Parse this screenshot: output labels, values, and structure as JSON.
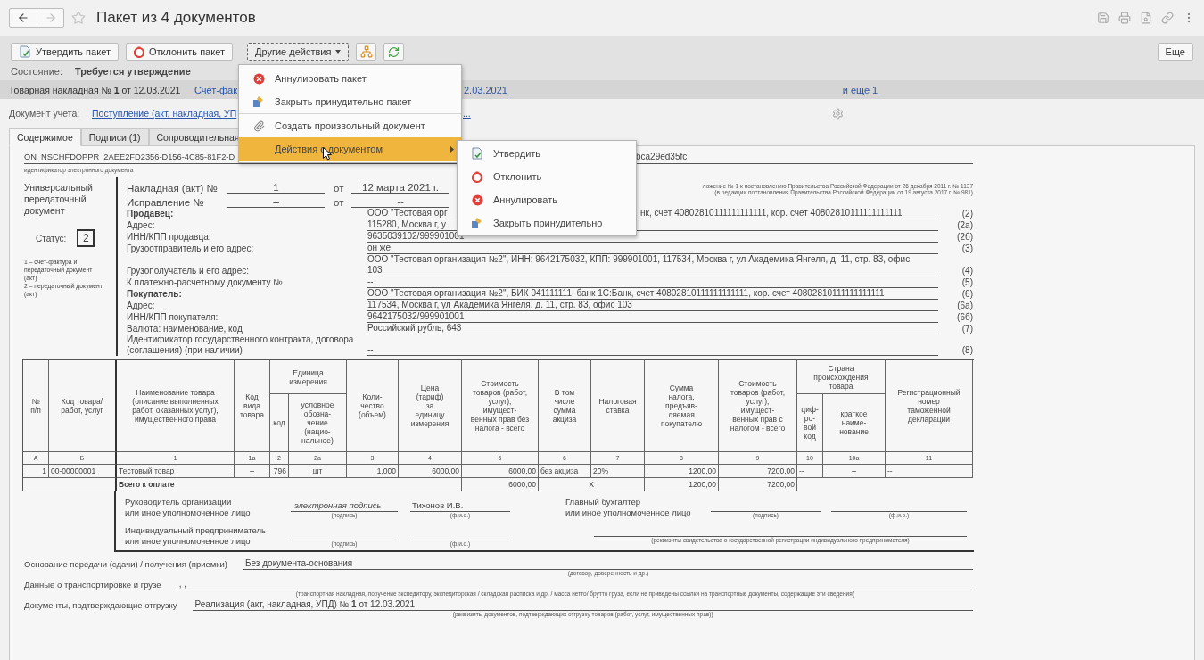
{
  "window": {
    "title": "Пакет из 4 документов",
    "favorite": false
  },
  "toolbar": {
    "buttons": [
      {
        "label": "Утвердить пакет",
        "kind": "approve",
        "open": false
      },
      {
        "label": "Отклонить пакет",
        "kind": "reject",
        "open": false
      },
      {
        "label": "Другие действия",
        "kind": "dropdown",
        "open": true
      }
    ],
    "icon_buttons": [
      {
        "kind": "structure"
      },
      {
        "kind": "refresh"
      }
    ],
    "more": "Еще"
  },
  "state": {
    "label": "Состояние:",
    "value": "Требуется утверждение"
  },
  "documents": {
    "current": "Товарная накладная № **1** от 12.03.2021",
    "links": [
      "Счет-фак",
      "2.03.2021",
      "и еще 1"
    ]
  },
  "account": {
    "label": "Документ учета:",
    "link": "Поступление (акт, накладная, УП",
    "link_tail": "..."
  },
  "tabs": [
    {
      "label": "Содержимое",
      "selected": true
    },
    {
      "label": "Подписи (1)",
      "selected": false
    },
    {
      "label": "Сопроводительная",
      "selected": false
    }
  ],
  "menu": {
    "items": [
      {
        "label": "Аннулировать пакет",
        "separator_before": false,
        "submenu": false,
        "selected": false
      },
      {
        "label": "Закрыть принудительно пакет",
        "separator_before": false,
        "submenu": false,
        "selected": false
      },
      {
        "label": "Создать произвольный документ",
        "separator_before": true,
        "submenu": false,
        "selected": false
      },
      {
        "label": "Действия с документом",
        "separator_before": false,
        "submenu": true,
        "selected": true
      }
    ]
  },
  "submenu": {
    "items": [
      {
        "label": "Утвердить"
      },
      {
        "label": "Отклонить"
      },
      {
        "label": "Аннулировать"
      },
      {
        "label": "Закрыть принудительно"
      }
    ]
  },
  "document": {
    "id_left": "ON_NSCHFDOPPR_2AEE2FD2356-D156-4C85-81F2-D",
    "id_right": "bca29ed35fc",
    "id_caption": "идентификатор электронного документа",
    "notes": [
      "ложение № 1 к постановлению Правительства Российской Федерации от 26 декабря 2011 г. № 1137",
      "(в редакции постановления Правительства Российской Федерации от 19 августа 2017 г. № 981)"
    ],
    "doc_type": "Универсальный передаточный документ",
    "status_label": "Статус:",
    "status_value": "2",
    "status_legend": [
      "1 – счет-фактура и передаточный документ (акт)",
      "2 – передаточный документ (акт)"
    ],
    "number_label": "Накладная (акт) №",
    "number": "1",
    "date_label": "от",
    "date": "12 марта 2021 г.",
    "correction_label": "Исправление №",
    "correction": "--",
    "correction_date_label": "от",
    "correction_date": "--",
    "fields": [
      {
        "label": "Продавец:",
        "bold": true,
        "value": "ООО \"Тестовая орг",
        "value_tail": "нк, счет 40802810111111111111, кор. счет 40802810111111111111",
        "code": "(2)"
      },
      {
        "label": "Адрес:",
        "bold": false,
        "value": "115280, Москва г, у",
        "code": "(2а)"
      },
      {
        "label": "ИНН/КПП продавца:",
        "bold": false,
        "value": "9635039102/999901001",
        "code": "(2б)"
      },
      {
        "label": "Грузоотправитель и его адрес:",
        "bold": false,
        "value": "он же",
        "code": "(3)"
      },
      {
        "label": "Грузополучатель и его адрес:",
        "bold": false,
        "value": "ООО \"Тестовая организация №2\", ИНН: 9642175032, КПП: 999901001, 117534, Москва г, ул Академика Янгеля, д. 11, стр. 83, офис\n103",
        "code": "(4)"
      },
      {
        "label": "К платежно-расчетному документу №",
        "bold": false,
        "value": "--",
        "code": "(5)"
      },
      {
        "label": "Покупатель:",
        "bold": true,
        "value": "ООО \"Тестовая организация №2\", БИК 041111111, банк 1С:Банк, счет 40802810111111111111, кор. счет 40802810111111111111",
        "code": "(6)"
      },
      {
        "label": "Адрес:",
        "bold": false,
        "value": "117534, Москва г, ул Академика Янгеля, д. 11, стр. 83, офис 103",
        "code": "(6а)"
      },
      {
        "label": "ИНН/КПП покупателя:",
        "bold": false,
        "value": "9642175032/999901001",
        "code": "(6б)"
      },
      {
        "label": "Валюта: наименование, код",
        "bold": false,
        "value": "Российский рубль, 643",
        "code": "(7)"
      },
      {
        "label": "Идентификатор государственного контракта, договора (соглашения) (при наличии)",
        "bold": false,
        "value": "--",
        "code": "(8)"
      }
    ]
  },
  "table": {
    "columns": [
      {
        "label": "№\nп/п",
        "number": "А"
      },
      {
        "label": "Код товара/\nработ, услуг",
        "number": "Б"
      },
      {
        "label": "Наименование товара\n(описание выполненных\nработ, оказанных услуг),\nимущественного права",
        "number": "1"
      },
      {
        "label": "Код\nвида\nтовара",
        "number": "1а"
      },
      {
        "group_start": "Единица\nизмерения",
        "label": "код",
        "number": "2"
      },
      {
        "in_group": true,
        "label": "условное\nобозна-\nчение\n(нацио-\nнальное)",
        "number": "2а"
      },
      {
        "label": "Коли-\nчество\n(объем)",
        "number": "3"
      },
      {
        "label": "Цена\n(тариф)\nза\nединицу\nизмерения",
        "number": "4"
      },
      {
        "label": "Стоимость\nтоваров (работ,\nуслуг),\nимущест-\nвенных прав без\nналога - всего",
        "number": "5"
      },
      {
        "label": "В том\nчисле\nсумма\nакциза",
        "number": "6"
      },
      {
        "label": "Налоговая\nставка",
        "number": "7"
      },
      {
        "label": "Сумма\nналога,\nпредъяв-\nляемая\nпокупателю",
        "number": "8"
      },
      {
        "label": "Стоимость\nтоваров (работ,\nуслуг),\nимущест-\nвенных прав с\nналогом - всего",
        "number": "9"
      },
      {
        "group_start": "Страна\nпроисхождения\nтовара",
        "label": "циф-\nро-\nвой\nкод",
        "number": "10"
      },
      {
        "in_group": true,
        "label": "краткое\nнаиме-\nнование",
        "number": "10а"
      },
      {
        "label": "Регистрационный\nномер\nтаможенной\nдекларации",
        "number": "11"
      }
    ],
    "rows": [
      [
        "1",
        "00-00000001",
        "Тестовый товар",
        "--",
        "796",
        "шт",
        "1,000",
        "6000,00",
        "6000,00",
        "без акциза",
        "20%",
        "1200,00",
        "7200,00",
        "--",
        "--",
        "--"
      ]
    ],
    "total": {
      "label": "Всего к оплате",
      "amount": "6000,00",
      "excise": "Х",
      "tax": "1200,00",
      "sum": "7200,00"
    }
  },
  "signatures": {
    "head": {
      "label": "Руководитель организации\nили иное уполномоченное лицо",
      "sign": "электронная подпись",
      "sign_caption": "(подпись)",
      "name": "Тихонов И.В.",
      "name_caption": "(ф.и.о.)"
    },
    "chief": {
      "label": "Главный бухгалтер\nили иное уполномоченное лицо",
      "sign_caption": "(подпись)",
      "name_caption": "(ф.и.о.)"
    },
    "entrepreneur": {
      "label": "Индивидуальный предприниматель\nили иное уполномоченное лицо",
      "sign_caption": "(подпись)",
      "name_caption": "(ф.и.о.)",
      "registration_caption": "(реквизиты свидетельства о государственной регистрации индивидуального предпринимателя)"
    }
  },
  "footer": [
    {
      "label": "Основание передачи (сдачи) / получения (приемки)",
      "value": "Без документа-основания",
      "caption": "(договор, доверенность и др.)"
    },
    {
      "label": "Данные о транспортировке и грузе",
      "value": ", ,",
      "caption": "(транспортная накладная, поручение экспедитору, экспедиторская / складская расписка и др. / масса нетто/ брутто груза, если не приведены ссылки на транспортные документы, содержащие эти сведения)"
    },
    {
      "label": "Документы, подтверждающие отгрузку",
      "value": "Реализация (акт, накладная, УПД) № **1** от 12.03.2021",
      "caption": "(реквизиты документов, подтверждающих отгрузку товаров (работ, услуг, имущественных прав))"
    }
  ]
}
